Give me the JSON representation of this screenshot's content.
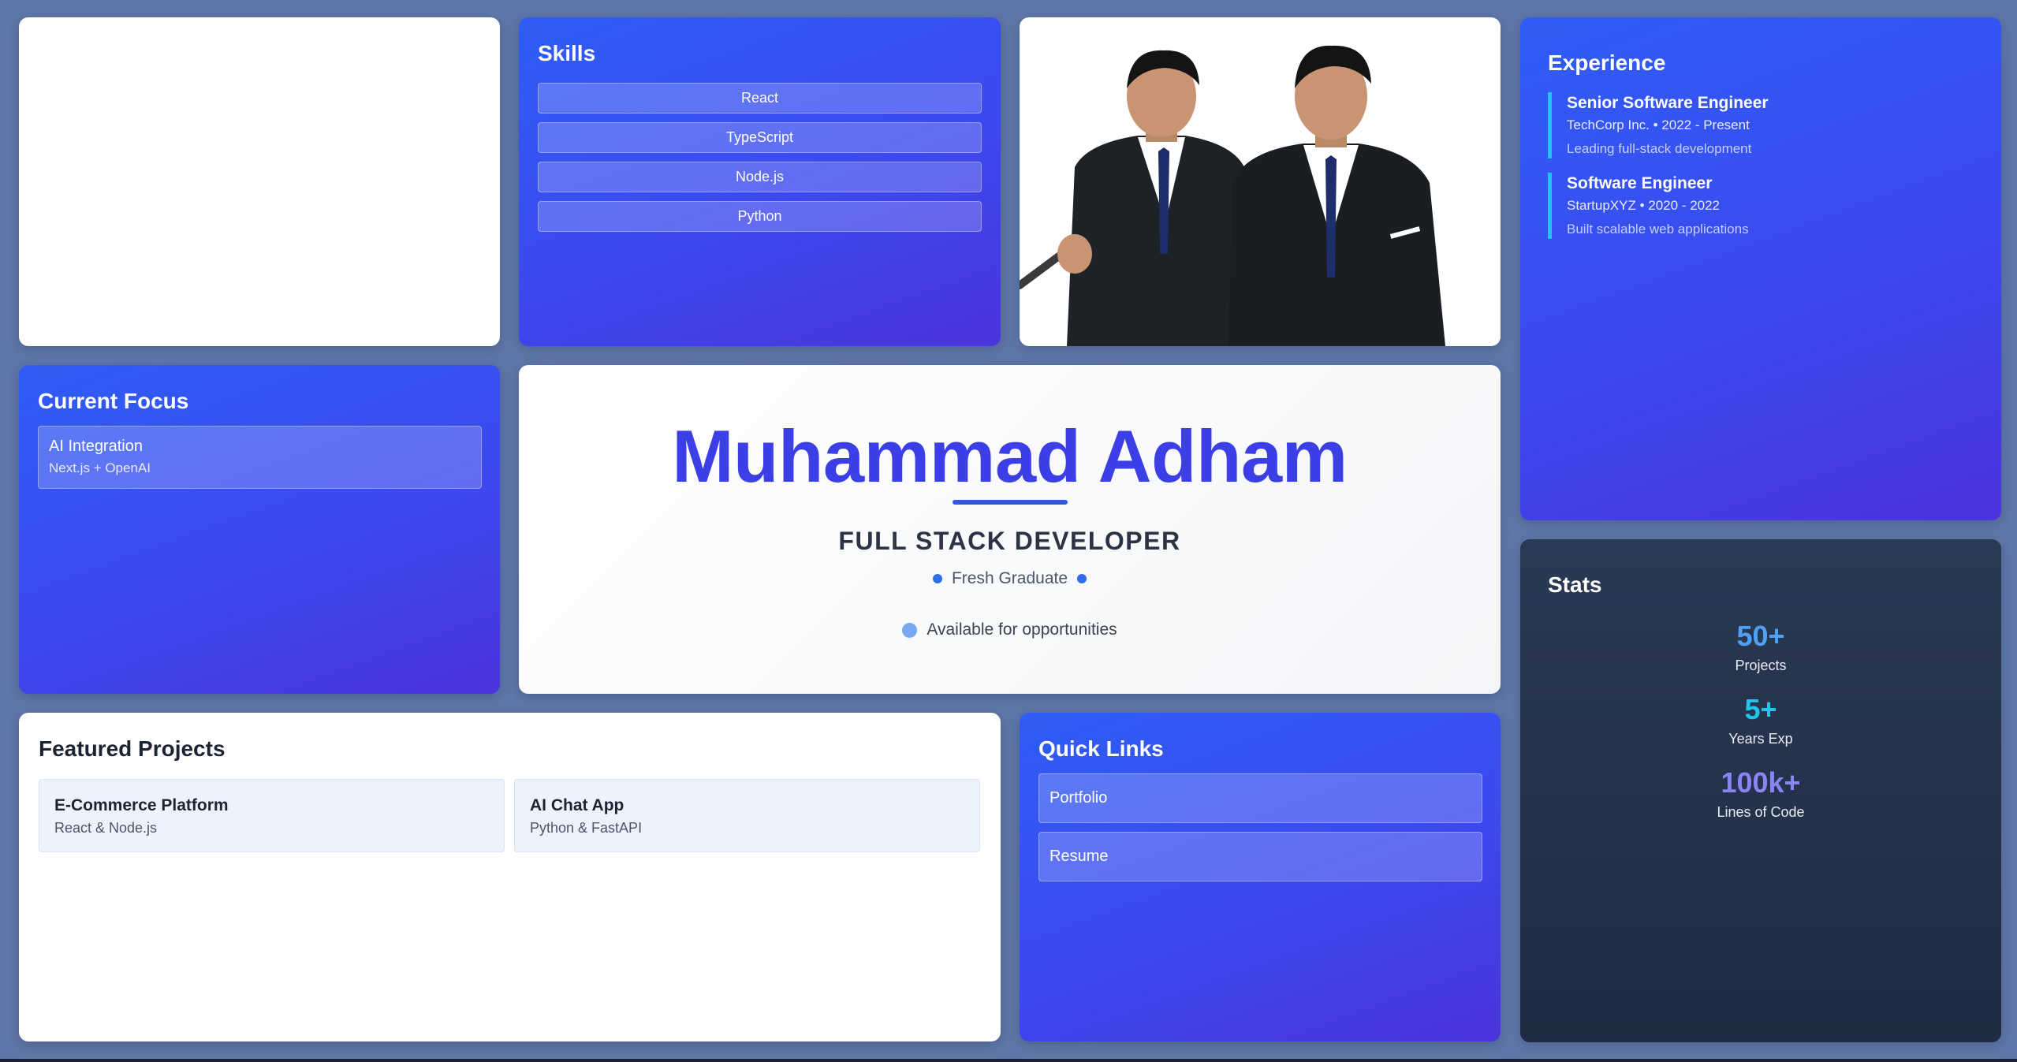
{
  "skills": {
    "title": "Skills",
    "items": [
      "React",
      "TypeScript",
      "Node.js",
      "Python"
    ]
  },
  "experience": {
    "title": "Experience",
    "items": [
      {
        "role": "Senior Software Engineer",
        "meta": "TechCorp Inc. • 2022 - Present",
        "desc": "Leading full-stack development"
      },
      {
        "role": "Software Engineer",
        "meta": "StartupXYZ • 2020 - 2022",
        "desc": "Built scalable web applications"
      }
    ],
    "accent_color": "#22c3f0"
  },
  "focus": {
    "title": "Current Focus",
    "item_title": "AI Integration",
    "item_sub": "Next.js + OpenAI"
  },
  "hero": {
    "name": "Muhammad Adham",
    "role": "FULL STACK DEVELOPER",
    "status": "Fresh Graduate",
    "availability": "Available for opportunities",
    "name_color": "#3d3fe6"
  },
  "stats": {
    "title": "Stats",
    "items": [
      {
        "value": "50+",
        "label": "Projects",
        "color": "#4ea1f5"
      },
      {
        "value": "5+",
        "label": "Years Exp",
        "color": "#22c6ea"
      },
      {
        "value": "100k+",
        "label": "Lines of Code",
        "color": "#8b84f5"
      }
    ]
  },
  "projects": {
    "title": "Featured Projects",
    "items": [
      {
        "title": "E-Commerce Platform",
        "sub": "React & Node.js"
      },
      {
        "title": "AI Chat App",
        "sub": "Python & FastAPI"
      }
    ]
  },
  "links": {
    "title": "Quick Links",
    "items": [
      "Portfolio",
      "Resume"
    ]
  },
  "photo": {
    "icon": "profile-photo"
  },
  "colors": {
    "background": "#5f77a8",
    "card_blue_start": "#2f5df5",
    "card_blue_end": "#4a33dd",
    "card_dark": "#1f2b42"
  }
}
